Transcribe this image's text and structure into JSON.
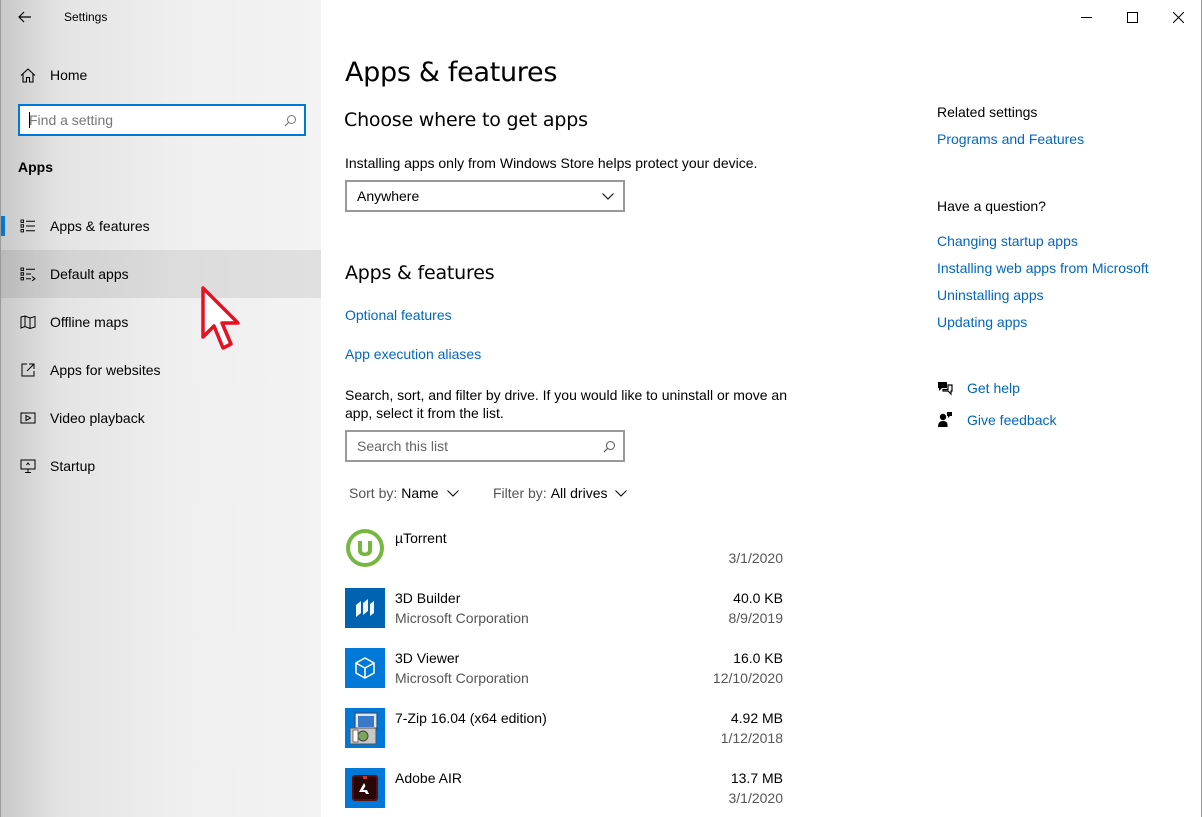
{
  "window": {
    "title": "Settings"
  },
  "sidebar": {
    "home_label": "Home",
    "search_placeholder": "Find a setting",
    "section_label": "Apps",
    "items": [
      {
        "label": "Apps & features",
        "icon": "list-icon",
        "selected": true
      },
      {
        "label": "Default apps",
        "icon": "default-apps-icon",
        "hover": true
      },
      {
        "label": "Offline maps",
        "icon": "map-icon"
      },
      {
        "label": "Apps for websites",
        "icon": "open-external-icon"
      },
      {
        "label": "Video playback",
        "icon": "video-icon"
      },
      {
        "label": "Startup",
        "icon": "startup-icon"
      }
    ]
  },
  "main": {
    "title": "Apps & features",
    "choose_heading": "Choose where to get apps",
    "choose_desc": "Installing apps only from Windows Store helps protect your device.",
    "source_dropdown_value": "Anywhere",
    "apps_heading": "Apps & features",
    "optional_features_link": "Optional features",
    "aliases_link": "App execution aliases",
    "search_desc_line1": "Search, sort, and filter by drive. If you would like to uninstall or move an",
    "search_desc_line2": "app, select it from the list.",
    "list_search_placeholder": "Search this list",
    "sort_label": "Sort by:",
    "sort_value": "Name",
    "filter_label": "Filter by:",
    "filter_value": "All drives",
    "apps": [
      {
        "name": "µTorrent",
        "publisher": "",
        "size": "",
        "date": "3/1/2020",
        "icon": "utorrent-icon"
      },
      {
        "name": "3D Builder",
        "publisher": "Microsoft Corporation",
        "size": "40.0 KB",
        "date": "8/9/2019",
        "icon": "3d-builder-icon"
      },
      {
        "name": "3D Viewer",
        "publisher": "Microsoft Corporation",
        "size": "16.0 KB",
        "date": "12/10/2020",
        "icon": "3d-viewer-icon"
      },
      {
        "name": "7-Zip 16.04 (x64 edition)",
        "publisher": "",
        "size": "4.92 MB",
        "date": "1/12/2018",
        "icon": "7zip-icon"
      },
      {
        "name": "Adobe AIR",
        "publisher": "",
        "size": "13.7 MB",
        "date": "3/1/2020",
        "icon": "adobe-air-icon"
      }
    ]
  },
  "related": {
    "heading": "Related settings",
    "programs_link": "Programs and Features",
    "question_heading": "Have a question?",
    "links": [
      "Changing startup apps",
      "Installing web apps from Microsoft",
      "Uninstalling apps",
      "Updating apps"
    ],
    "get_help": "Get help",
    "give_feedback": "Give feedback"
  },
  "colors": {
    "accent": "#0078d7",
    "link": "#0067c0",
    "cursor": "#e81123"
  }
}
